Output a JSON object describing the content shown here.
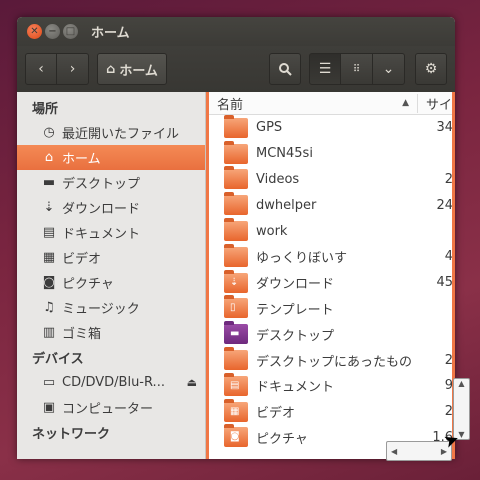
{
  "window": {
    "title": "ホーム"
  },
  "toolbar": {
    "back_icon": "chevron-left-icon",
    "forward_icon": "chevron-right-icon",
    "path_label": "ホーム",
    "search_icon": "search-icon",
    "list_view_icon": "list-view-icon",
    "grid_view_icon": "grid-view-icon",
    "view_menu_icon": "chevron-down-icon",
    "settings_icon": "gear-icon"
  },
  "sidebar": {
    "places_header": "場所",
    "places": [
      {
        "label": "最近開いたファイル",
        "icon": "clock-icon"
      },
      {
        "label": "ホーム",
        "icon": "home-icon",
        "active": true
      },
      {
        "label": "デスクトップ",
        "icon": "folder-icon"
      },
      {
        "label": "ダウンロード",
        "icon": "download-icon"
      },
      {
        "label": "ドキュメント",
        "icon": "document-icon"
      },
      {
        "label": "ビデオ",
        "icon": "film-icon"
      },
      {
        "label": "ピクチャ",
        "icon": "camera-icon"
      },
      {
        "label": "ミュージック",
        "icon": "music-icon"
      },
      {
        "label": "ゴミ箱",
        "icon": "trash-icon"
      }
    ],
    "devices_header": "デバイス",
    "devices": [
      {
        "label": "CD/DVD/Blu-R...",
        "icon": "optical-drive-icon"
      },
      {
        "label": "コンピューター",
        "icon": "computer-icon"
      }
    ],
    "network_header": "ネットワーク"
  },
  "columns": {
    "name": "名前",
    "size": "サイ"
  },
  "files": [
    {
      "name": "GPS",
      "size": "34"
    },
    {
      "name": "MCN45si",
      "size": ""
    },
    {
      "name": "Videos",
      "size": "2"
    },
    {
      "name": "dwhelper",
      "size": "24"
    },
    {
      "name": "work",
      "size": ""
    },
    {
      "name": "ゆっくりぼいす",
      "size": "4"
    },
    {
      "name": "ダウンロード",
      "size": "45"
    },
    {
      "name": "テンプレート",
      "size": ""
    },
    {
      "name": "デスクトップ",
      "size": ""
    },
    {
      "name": "デスクトップにあったもの",
      "size": "2"
    },
    {
      "name": "ドキュメント",
      "size": "9"
    },
    {
      "name": "ビデオ",
      "size": "2"
    },
    {
      "name": "ピクチャ",
      "size": "1.6"
    }
  ],
  "colors": {
    "accent": "#f07746",
    "titlebar": "#3c3b37"
  }
}
